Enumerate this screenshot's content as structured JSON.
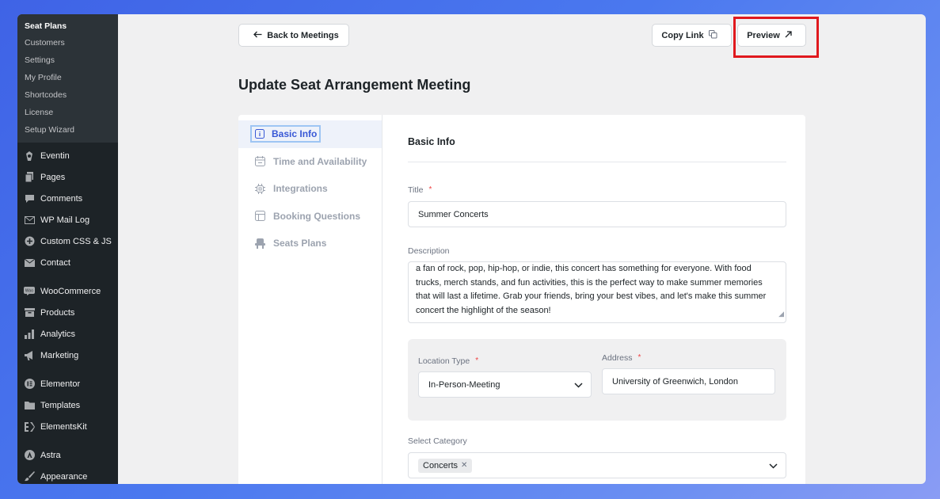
{
  "sidebar": {
    "submenu_title": "Seat Plans",
    "submenu_items": [
      {
        "label": "Customers"
      },
      {
        "label": "Settings"
      },
      {
        "label": "My Profile"
      },
      {
        "label": "Shortcodes"
      },
      {
        "label": "License"
      },
      {
        "label": "Setup Wizard"
      }
    ],
    "menu_group_1": [
      {
        "label": "Eventin",
        "icon": "eventin-icon"
      },
      {
        "label": "Pages",
        "icon": "pages-icon"
      },
      {
        "label": "Comments",
        "icon": "comments-icon"
      },
      {
        "label": "WP Mail Log",
        "icon": "mail-icon"
      },
      {
        "label": "Custom CSS & JS",
        "icon": "plus-circle-icon"
      },
      {
        "label": "Contact",
        "icon": "envelope-icon"
      }
    ],
    "menu_group_2": [
      {
        "label": "WooCommerce",
        "icon": "woocommerce-icon"
      },
      {
        "label": "Products",
        "icon": "products-icon"
      },
      {
        "label": "Analytics",
        "icon": "analytics-icon"
      },
      {
        "label": "Marketing",
        "icon": "megaphone-icon"
      }
    ],
    "menu_group_3": [
      {
        "label": "Elementor",
        "icon": "elementor-icon"
      },
      {
        "label": "Templates",
        "icon": "folder-icon"
      },
      {
        "label": "ElementsKit",
        "icon": "elementskit-icon"
      }
    ],
    "menu_group_4": [
      {
        "label": "Astra",
        "icon": "astra-icon"
      },
      {
        "label": "Appearance",
        "icon": "brush-icon"
      }
    ]
  },
  "toolbar": {
    "back_label": "Back to Meetings",
    "copy_label": "Copy Link",
    "preview_label": "Preview"
  },
  "page": {
    "title": "Update Seat Arrangement Meeting"
  },
  "tabs": [
    {
      "label": "Basic Info",
      "icon": "info-icon",
      "active": true
    },
    {
      "label": "Time and Availability",
      "icon": "calendar-icon"
    },
    {
      "label": "Integrations",
      "icon": "integration-icon"
    },
    {
      "label": "Booking Questions",
      "icon": "table-icon"
    },
    {
      "label": "Seats Plans",
      "icon": "seat-icon"
    }
  ],
  "form": {
    "section_title": "Basic Info",
    "title_label": "Title",
    "title_value": "Summer Concerts",
    "description_label": "Description",
    "description_value": "a fan of rock, pop, hip-hop, or indie, this concert has something for everyone. With food trucks, merch stands, and fun activities, this is the perfect way to make summer memories that will last a lifetime. Grab your friends, bring your best vibes, and let's make this summer concert the highlight of the season!",
    "location_type_label": "Location Type",
    "location_type_value": "In-Person-Meeting",
    "address_label": "Address",
    "address_value": "University of Greenwich, London",
    "category_label": "Select Category",
    "category_tags": [
      "Concerts"
    ],
    "required_mark": "*"
  },
  "colors": {
    "accent": "#3858d6",
    "highlight": "#e0191e",
    "sidebar_bg": "#1d2327"
  }
}
